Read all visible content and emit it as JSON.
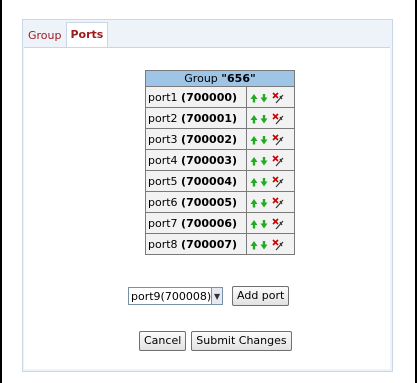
{
  "tabs": [
    {
      "label": "Group",
      "active": false
    },
    {
      "label": "Ports",
      "active": true
    }
  ],
  "group": {
    "header_prefix": "Group ",
    "name": "\"656\""
  },
  "ports": [
    {
      "name": "port1",
      "id": "700000"
    },
    {
      "name": "port2",
      "id": "700001"
    },
    {
      "name": "port3",
      "id": "700002"
    },
    {
      "name": "port4",
      "id": "700003"
    },
    {
      "name": "port5",
      "id": "700004"
    },
    {
      "name": "port6",
      "id": "700005"
    },
    {
      "name": "port7",
      "id": "700006"
    },
    {
      "name": "port8",
      "id": "700007"
    }
  ],
  "add_controls": {
    "select_value": "port9(700008)",
    "add_label": "Add port"
  },
  "buttons": {
    "cancel_label": "Cancel",
    "submit_label": "Submit Changes"
  },
  "colors": {
    "tab_text": "#9a1b1b",
    "header_bg": "#9ec4e6",
    "row_bg": "#f2f2f2",
    "arrow_green": "#22aa22",
    "delete_red": "#cc0000"
  },
  "icons": [
    "arrow-up-icon",
    "arrow-down-icon",
    "delete-icon",
    "chevron-down-icon"
  ]
}
